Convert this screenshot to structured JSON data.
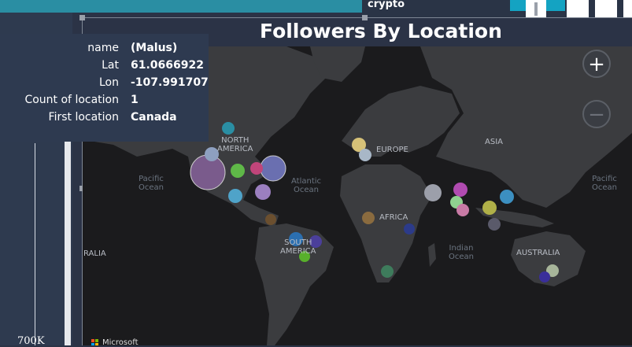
{
  "top_bar": {
    "label": "crypto"
  },
  "visual": {
    "title": "Followers By Location"
  },
  "tooltip": {
    "rows": [
      {
        "key": "name",
        "value": "(Malus)"
      },
      {
        "key": "Lat",
        "value": "61.0666922"
      },
      {
        "key": "Lon",
        "value": "-107.991707"
      },
      {
        "key": "Count of location",
        "value": "1"
      },
      {
        "key": "First location",
        "value": "Canada"
      }
    ]
  },
  "left_panel": {
    "axis_tick": "700K"
  },
  "map": {
    "labels": {
      "north_america": "NORTH\nAMERICA",
      "europe": "EUROPE",
      "asia": "ASIA",
      "africa": "AFRICA",
      "south_america": "SOUTH\nAMERICA",
      "australia": "AUSTRALIA",
      "australia_left": "RALIA",
      "pacific_left": "Pacific\nOcean",
      "atlantic": "Atlantic\nOcean",
      "indian": "Indian\nOcean",
      "pacific_right": "Pacific\nOcean"
    },
    "zoom_in": "+",
    "zoom_out": "−",
    "attribution": "Microsoft"
  },
  "colors": {
    "background": "#2b3346",
    "map_land": "#3b3c3f",
    "map_water": "#1b1b1d",
    "teal": "#14a3c2"
  }
}
